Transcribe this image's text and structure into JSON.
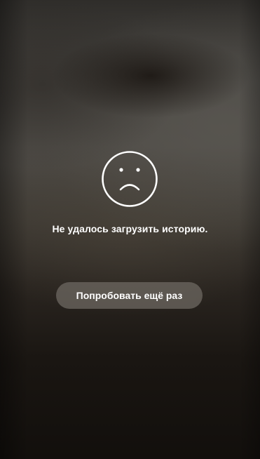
{
  "error": {
    "icon": "sad-face-icon",
    "message": "Не удалось загрузить историю."
  },
  "actions": {
    "retry_label": "Попробовать ещё раз"
  },
  "colors": {
    "text": "#ffffff",
    "button_background": "#6e6862"
  }
}
